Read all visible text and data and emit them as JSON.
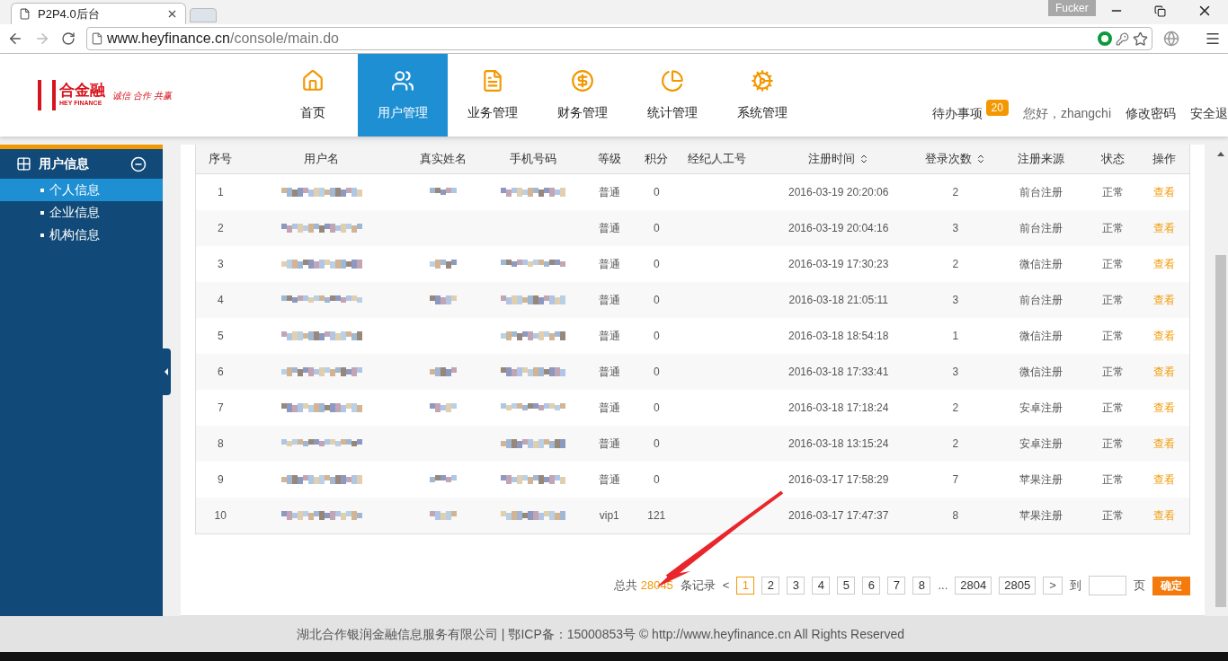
{
  "browser": {
    "tab_title": "P2P4.0后台",
    "profile": "Fucker",
    "url_host": "www.heyfinance.cn",
    "url_path": "/console/main.do"
  },
  "header": {
    "logo": {
      "name": "合金融",
      "sub": "HEY FINANCE",
      "slogan": "诚信 合作 共赢"
    },
    "nav": [
      {
        "label": "首页",
        "selected": false
      },
      {
        "label": "用户管理",
        "selected": true
      },
      {
        "label": "业务管理",
        "selected": false
      },
      {
        "label": "财务管理",
        "selected": false
      },
      {
        "label": "统计管理",
        "selected": false
      },
      {
        "label": "系统管理",
        "selected": false
      }
    ],
    "todo": {
      "label": "待办事项",
      "count": "20"
    },
    "greeting": "您好，zhangchi",
    "change_password": "修改密码",
    "logout": "安全退"
  },
  "sidebar": {
    "group": {
      "label": "用户信息",
      "expanded": true
    },
    "items": [
      {
        "label": "个人信息",
        "selected": true
      },
      {
        "label": "企业信息",
        "selected": false
      },
      {
        "label": "机构信息",
        "selected": false
      }
    ]
  },
  "table": {
    "columns": [
      {
        "label": "序号",
        "kind": "plain"
      },
      {
        "label": "用户名",
        "kind": "plain"
      },
      {
        "label": "真实姓名",
        "kind": "plain"
      },
      {
        "label": "手机号码",
        "kind": "plain"
      },
      {
        "label": "等级",
        "kind": "plain"
      },
      {
        "label": "积分",
        "kind": "plain"
      },
      {
        "label": "经纪人工号",
        "kind": "plain"
      },
      {
        "label": "注册时间",
        "kind": "sortable"
      },
      {
        "label": "登录次数",
        "kind": "sortable"
      },
      {
        "label": "注册来源",
        "kind": "plain"
      },
      {
        "label": "状态",
        "kind": "plain"
      },
      {
        "label": "操作",
        "kind": "plain"
      }
    ],
    "rows": [
      {
        "no": "1",
        "username_masked": true,
        "real_name_masked": true,
        "phone_masked": true,
        "level": "普通",
        "points": "0",
        "registered": "2016-03-19 20:20:06",
        "logins": "2",
        "source": "前台注册",
        "status": "正常",
        "action": "查看"
      },
      {
        "no": "2",
        "username_masked": true,
        "real_name_masked": false,
        "phone_masked": false,
        "level": "普通",
        "points": "0",
        "registered": "2016-03-19 20:04:16",
        "logins": "3",
        "source": "前台注册",
        "status": "正常",
        "action": "查看"
      },
      {
        "no": "3",
        "username_masked": true,
        "real_name_masked": true,
        "phone_masked": true,
        "level": "普通",
        "points": "0",
        "registered": "2016-03-19 17:30:23",
        "logins": "2",
        "source": "微信注册",
        "status": "正常",
        "action": "查看"
      },
      {
        "no": "4",
        "username_masked": true,
        "real_name_masked": true,
        "phone_masked": true,
        "level": "普通",
        "points": "0",
        "registered": "2016-03-18 21:05:11",
        "logins": "3",
        "source": "前台注册",
        "status": "正常",
        "action": "查看"
      },
      {
        "no": "5",
        "username_masked": true,
        "real_name_masked": false,
        "phone_masked": true,
        "level": "普通",
        "points": "0",
        "registered": "2016-03-18 18:54:18",
        "logins": "1",
        "source": "微信注册",
        "status": "正常",
        "action": "查看"
      },
      {
        "no": "6",
        "username_masked": true,
        "real_name_masked": true,
        "phone_masked": true,
        "level": "普通",
        "points": "0",
        "registered": "2016-03-18 17:33:41",
        "logins": "3",
        "source": "微信注册",
        "status": "正常",
        "action": "查看"
      },
      {
        "no": "7",
        "username_masked": true,
        "real_name_masked": true,
        "phone_masked": true,
        "level": "普通",
        "points": "0",
        "registered": "2016-03-18 17:18:24",
        "logins": "2",
        "source": "安卓注册",
        "status": "正常",
        "action": "查看"
      },
      {
        "no": "8",
        "username_masked": true,
        "real_name_masked": false,
        "phone_masked": true,
        "level": "普通",
        "points": "0",
        "registered": "2016-03-18 13:15:24",
        "logins": "2",
        "source": "安卓注册",
        "status": "正常",
        "action": "查看"
      },
      {
        "no": "9",
        "username_masked": true,
        "real_name_masked": true,
        "phone_masked": true,
        "level": "普通",
        "points": "0",
        "registered": "2016-03-17 17:58:29",
        "logins": "7",
        "source": "苹果注册",
        "status": "正常",
        "action": "查看"
      },
      {
        "no": "10",
        "username_masked": true,
        "real_name_masked": true,
        "phone_masked": true,
        "level": "vip1",
        "points": "121",
        "registered": "2016-03-17 17:47:37",
        "logins": "8",
        "source": "苹果注册",
        "status": "正常",
        "action": "查看"
      }
    ]
  },
  "pagination": {
    "total_prefix": "总共",
    "total": "28045",
    "total_suffix": "条记录",
    "prev": "<",
    "pages": [
      {
        "label": "1",
        "selected": true
      },
      {
        "label": "2",
        "selected": false
      },
      {
        "label": "3",
        "selected": false
      },
      {
        "label": "4",
        "selected": false
      },
      {
        "label": "5",
        "selected": false
      },
      {
        "label": "6",
        "selected": false
      },
      {
        "label": "7",
        "selected": false
      },
      {
        "label": "8",
        "selected": false
      },
      {
        "label": "...",
        "kind": "gap"
      },
      {
        "label": "2804",
        "selected": false
      },
      {
        "label": "2805",
        "selected": false
      }
    ],
    "next": ">",
    "goto_label": "到",
    "page_label": "页",
    "confirm": "确定"
  },
  "footer": "湖北合作银润金融信息服务有限公司 | 鄂ICP备：15000853号 © http://www.heyfinance.cn All Rights Reserved"
}
